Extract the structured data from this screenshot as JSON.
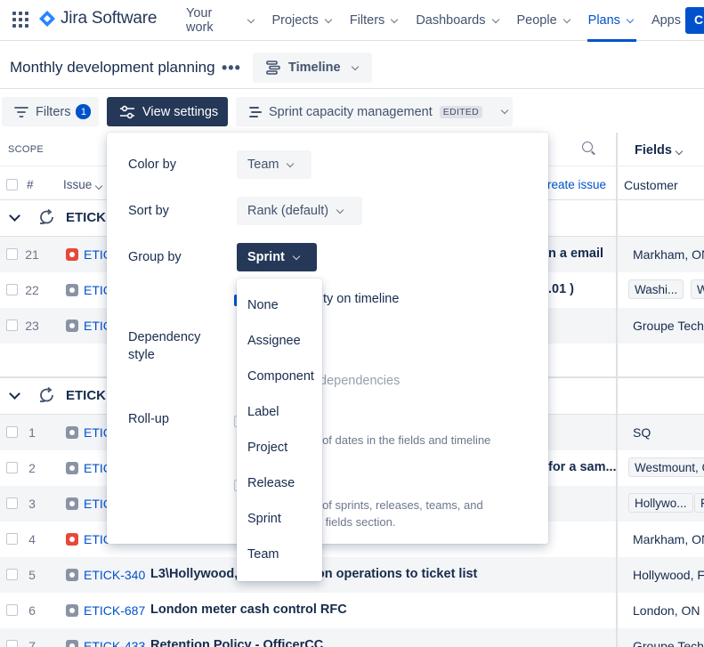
{
  "nav": {
    "product": "Jira Software",
    "items": [
      {
        "label": "Your work",
        "active": false
      },
      {
        "label": "Projects",
        "active": false
      },
      {
        "label": "Filters",
        "active": false
      },
      {
        "label": "Dashboards",
        "active": false
      },
      {
        "label": "People",
        "active": false
      },
      {
        "label": "Plans",
        "active": true
      },
      {
        "label": "Apps",
        "active": false
      }
    ],
    "create_label": "C",
    "accent": "#0052CC"
  },
  "plan": {
    "title": "Monthly development planning",
    "view_label": "Timeline"
  },
  "toolbar": {
    "filters_label": "Filters",
    "filters_count": "1",
    "view_settings_label": "View settings",
    "capacity_label": "Sprint capacity management",
    "edited_badge": "EDITED"
  },
  "table": {
    "scope_label": "SCOPE",
    "fields_label": "Fields",
    "col_hash": "#",
    "col_issue": "Issue",
    "create_issue": "reate issue",
    "col_customer": "Customer",
    "groups": [
      {
        "name": "ETICK"
      },
      {
        "name": "ETICK"
      }
    ],
    "rows": [
      {
        "num": "21",
        "key": "ETIC",
        "type": "bug",
        "summary_tail": "n a email",
        "customer": "Markham, ON"
      },
      {
        "num": "22",
        "key": "ETIC",
        "type": "task",
        "summary_tail": ".01 )",
        "chip1": "Washi...",
        "chip2": "W"
      },
      {
        "num": "23",
        "key": "ETIC",
        "type": "task",
        "summary_tail": "",
        "customer": "Groupe Techr"
      },
      {
        "num": "1",
        "key": "ETIC",
        "type": "task",
        "summary_tail": "",
        "customer": "SQ"
      },
      {
        "num": "2",
        "key": "ETIC",
        "type": "task",
        "summary_tail": "for a sam...",
        "chip1": "Westmount, C"
      },
      {
        "num": "3",
        "key": "ETIC",
        "type": "task",
        "summary_tail": "",
        "chip1": "Hollywo...",
        "chip2": "F"
      },
      {
        "num": "4",
        "key": "ETIC",
        "type": "bug",
        "summary_tail": "",
        "customer": "Markham, ON"
      },
      {
        "num": "5",
        "key": "ETICK-340",
        "type": "task",
        "summary": "L3\\Hollywood,",
        "summary_tail": "nsaction operations to ticket list",
        "customer": "Hollywood, F"
      },
      {
        "num": "6",
        "key": "ETICK-687",
        "type": "task",
        "summary": "London meter cash control RFC",
        "summary_tail": "",
        "customer": "London, ON"
      },
      {
        "num": "7",
        "key": "ETICK-433",
        "type": "task",
        "summary": "Retention Policy - OfficerCC",
        "summary_tail": "",
        "customer": "Groupe Techr"
      }
    ]
  },
  "view_settings": {
    "color_by_label": "Color by",
    "color_by_value": "Team",
    "sort_by_label": "Sort by",
    "sort_by_value": "Rank (default)",
    "group_by_label": "Group by",
    "group_by_value": "Sprint",
    "show_capacity_tail": "ty on timeline",
    "dependency_label": "Dependency style",
    "dependency_tail": "er of dependencies",
    "rollup_label": "Roll-up",
    "rollup_dates_tail": "up of dates in the fields and timeline",
    "rollup_other_tail_1": "up of sprints, releases, teams, and",
    "rollup_other_tail_2": "the fields section."
  },
  "group_by_options": [
    "None",
    "Assignee",
    "Component",
    "Label",
    "Project",
    "Release",
    "Sprint",
    "Team"
  ]
}
